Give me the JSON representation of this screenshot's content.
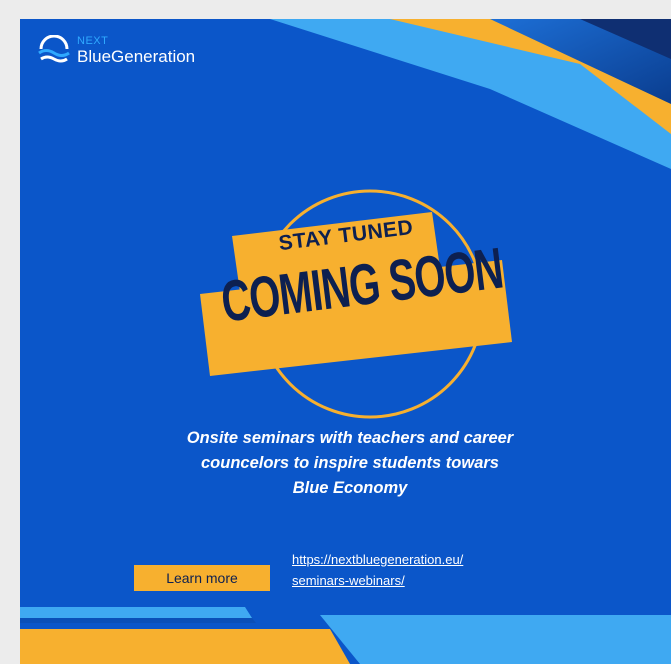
{
  "logo": {
    "top_word": "NEXT",
    "name": "BlueGeneration"
  },
  "badge": {
    "line1": "STAY TUNED",
    "line2": "COMING SOON"
  },
  "headline": {
    "lines": [
      "Onsite seminars with teachers and career",
      "councelors to inspire students towars",
      "Blue Economy"
    ]
  },
  "cta": {
    "button_label": "Learn more",
    "link_lines": [
      "https://nextbluegeneration.eu/",
      "seminars-webinars/"
    ]
  },
  "colors": {
    "background_blue": "#0b56c9",
    "accent_yellow": "#f7b02f",
    "dark_navy": "#0d2050",
    "light_blue": "#39a8f0"
  }
}
